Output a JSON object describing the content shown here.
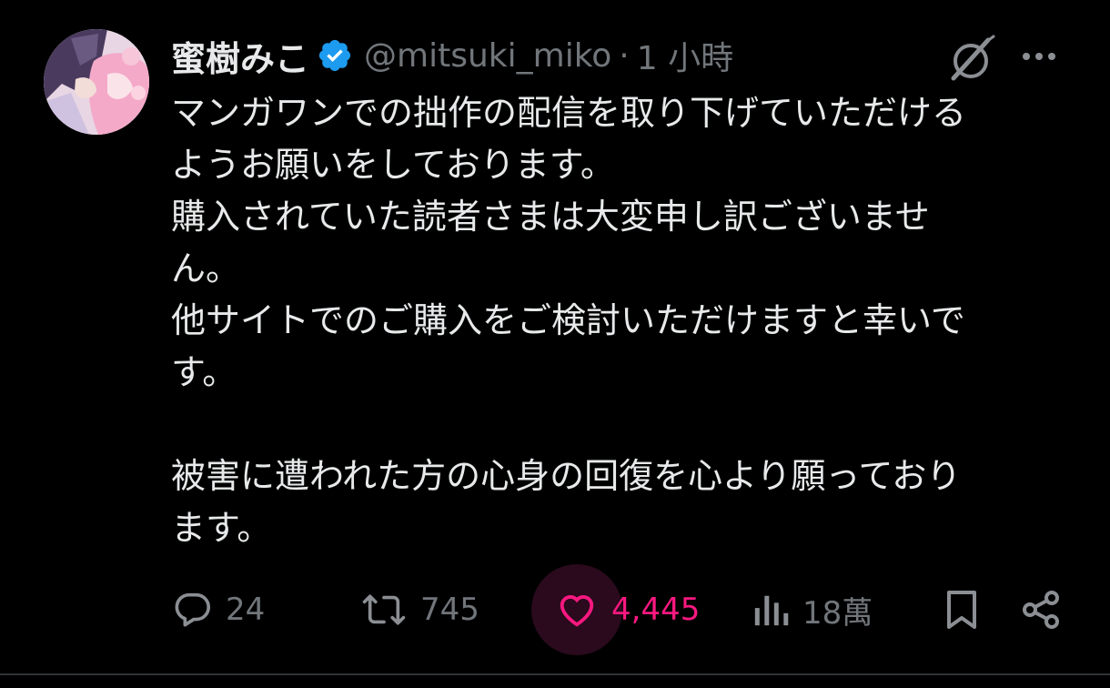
{
  "author": {
    "display_name": "蜜樹みこ",
    "handle": "@mitsuki_miko",
    "separator": "·",
    "time": "1 小時",
    "avatar_icon": "avatar-illustration",
    "verified_icon": "verified-badge-icon",
    "verified_color": "#1d9bf0"
  },
  "tweet": {
    "lines": [
      "マンガワンでの拙作の配信を取り下げていただける",
      "ようお願いをしております。",
      "購入されていた読者さまは大変申し訳ございませ",
      "ん。",
      "他サイトでのご購入をご検討いただけますと幸いで",
      "す。",
      "",
      "被害に遭われた方の心身の回復を心より願っており",
      "ます。"
    ]
  },
  "actions": {
    "reply": {
      "icon": "reply-icon",
      "count": "24"
    },
    "retweet": {
      "icon": "retweet-icon",
      "count": "745"
    },
    "like": {
      "icon": "heart-icon",
      "count": "4,445",
      "active_color": "#f91880"
    },
    "views": {
      "icon": "analytics-icon",
      "count": "18萬"
    },
    "bookmark": {
      "icon": "bookmark-icon"
    },
    "share": {
      "icon": "share-icon"
    }
  },
  "top_icons": {
    "grok": "grok-icon",
    "more": "more-icon"
  },
  "colors": {
    "background": "#000000",
    "text": "#e7e9ea",
    "muted": "#71767b"
  }
}
